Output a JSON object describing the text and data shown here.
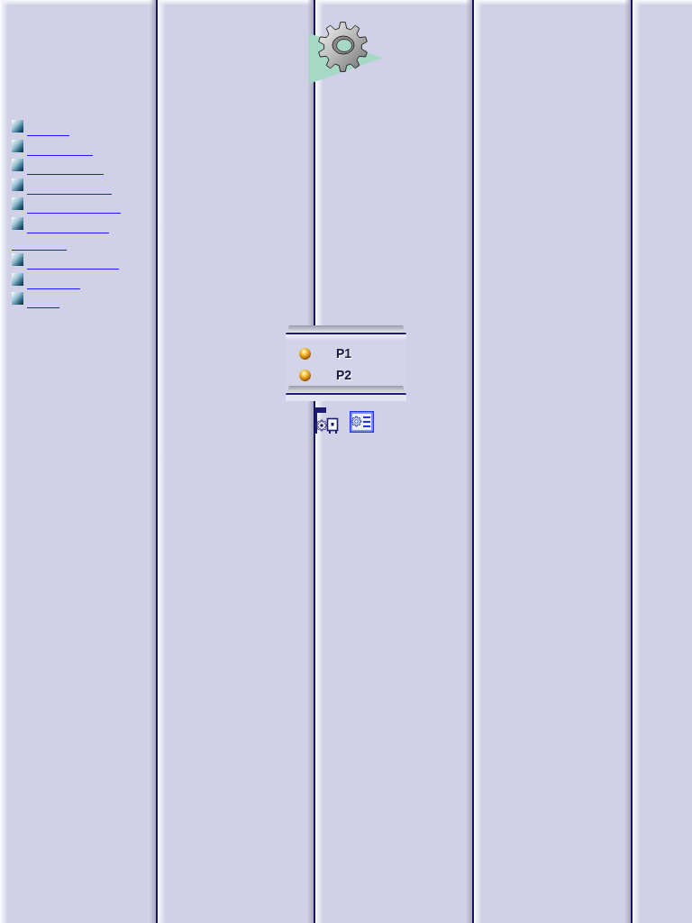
{
  "sidebar": {
    "links": [
      {
        "kind": "link"
      },
      {
        "kind": "link"
      },
      {
        "kind": "link"
      },
      {
        "kind": "link"
      },
      {
        "kind": "link"
      },
      {
        "kind": "wrapped-link"
      },
      {
        "kind": "link"
      },
      {
        "kind": "link"
      },
      {
        "kind": "link"
      }
    ]
  },
  "panel": {
    "items": [
      {
        "label": "P1"
      },
      {
        "label": "P2"
      }
    ]
  }
}
